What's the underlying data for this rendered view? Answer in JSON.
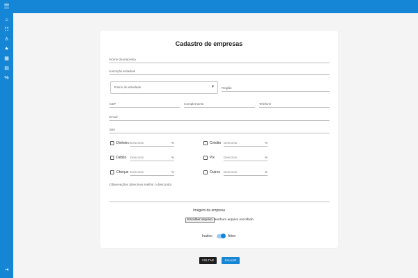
{
  "sidebar": {
    "icons": [
      "home-icon",
      "list-icon",
      "user-plus-icon",
      "star-icon",
      "building-icon",
      "report-icon",
      "percent-icon",
      "logout-icon"
    ]
  },
  "form": {
    "title": "Cadastro de empresas",
    "nome_empresa": "Nome da empresa",
    "inscricao_estadual": "Inscrição estadual",
    "ramo_atividade": "Ramo de atividade",
    "regiao": "Região",
    "cep": "CEP",
    "complemento": "Complemento",
    "telefone": "Telefone",
    "email": "Email",
    "site": "Site",
    "discount_placeholder": "Desconto",
    "percent": "%",
    "payments_left": [
      "Dinheiro",
      "Débito",
      "Cheque"
    ],
    "payments_right": [
      "Crédito",
      "Pix",
      "Outros"
    ],
    "observacoes": "Observações (descreva melhor o desconto)",
    "imagem_label": "Imagem da empresa",
    "file_button": "Escolher arquivo",
    "file_status": "Nenhum arquivo escolhido",
    "toggle_off": "Inativo",
    "toggle_on": "Ativo"
  },
  "actions": {
    "back": "VOLTAR",
    "save": "SALVAR"
  },
  "colors": {
    "primary": "#1586d6",
    "dark_button": "#1e1e1e",
    "background": "#f4f4f4"
  }
}
